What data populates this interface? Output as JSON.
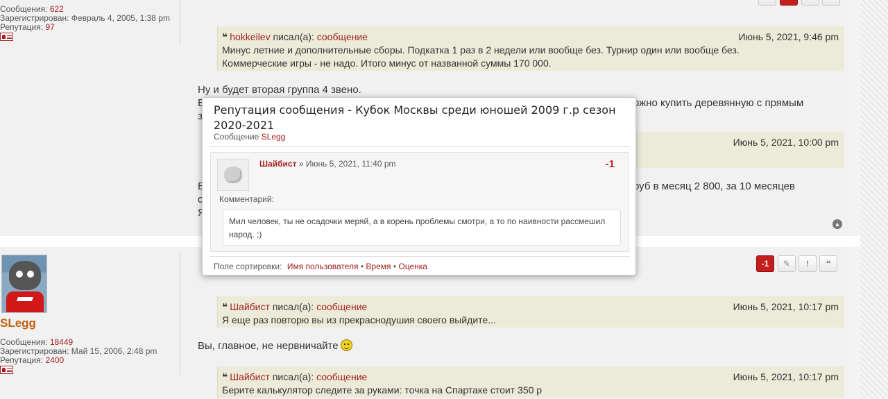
{
  "post1": {
    "profile": {
      "posts_label": "Сообщения:",
      "posts_value": "622",
      "registered_label": "Зарегистрирован:",
      "registered_value": "Февраль 4, 2005, 1:38 pm",
      "rep_label": "Репутация:",
      "rep_value": "97"
    },
    "quote": {
      "author": "hokkeilev",
      "wrote": "писал(а):",
      "link": "сообщение",
      "date": "Июнь 5, 2021, 9:46 pm",
      "line1": "Минус летние и дополнительные сборы. Подкатка 1 раз в 2 недели или вообще без. Турнир один или вообще без.",
      "line2": "Коммерческие игры - не надо. Итого минус от названной суммы 170 000."
    },
    "text1": "Ну и будет вторая группа 4 звено.",
    "text2_start": "В",
    "text2_end": "ожно купить деревянную с прямым",
    "text3_start": "з",
    "quote2_date": "Июнь 5, 2021, 10:00 pm",
    "text4_start": "Е",
    "text4_end": "руб в месяц  2 800, за 10 месяцев",
    "text5_start": "с",
    "text6_start": "Я"
  },
  "post2": {
    "username": "SLegg",
    "profile": {
      "posts_label": "Сообщения:",
      "posts_value": "18449",
      "registered_label": "Зарегистрирован:",
      "registered_value": "Май 15, 2006, 2:48 pm",
      "rep_label": "Репутация:",
      "rep_value": "2400"
    },
    "buttons": {
      "rep": "-1",
      "edit": "✎",
      "report": "!",
      "quote": "❝"
    },
    "quote1": {
      "author": "Шайбист",
      "wrote": "писал(а):",
      "link": "сообщение",
      "date": "Июнь 5, 2021, 10:17 pm",
      "text": "Я еще раз повторю вы из прекраснодушия своего выйдите..."
    },
    "text": "Вы, главное, не нервничайте",
    "quote2": {
      "author": "Шайбист",
      "wrote": "писал(а):",
      "link": "сообщение",
      "date": "Июнь 5, 2021, 10:17 pm",
      "text": "Берите калькулятор следите за руками: точка на Спартаке стоит 350 р"
    }
  },
  "popup": {
    "title": "Репутация сообщения - Кубок Москвы среди юношей 2009 г.р сезон 2020-2021",
    "sub_label": "Сообщение",
    "sub_user": "SLegg",
    "entry": {
      "user": "Шайбист",
      "sep": "»",
      "date": "Июнь 5, 2021, 11:40 pm",
      "score": "-1",
      "comment_label": "Комментарий:",
      "comment": "Мил человек, ты не осадочки меряй, а в корень проблемы смотри, а то по наивности рассмешил народ. ;)"
    },
    "sort_label": "Поле сортировки:",
    "sort_options": [
      "Имя пользователя",
      "Время",
      "Оценка"
    ],
    "sort_sep": "•"
  },
  "colors": {
    "accent": "#a32020",
    "rep_negative": "#c41e1e",
    "quote_bg": "#ecebd9",
    "username": "#c06010"
  }
}
